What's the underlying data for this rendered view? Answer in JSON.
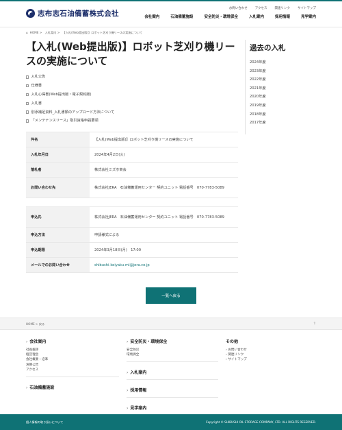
{
  "brand": {
    "name": "志布志石油備蓄株式会社"
  },
  "util_nav": [
    "お問い合わせ",
    "アクセス",
    "関連リンク",
    "サイトマップ"
  ],
  "global_nav": [
    "会社案内",
    "石油備蓄施設",
    "安全防災・環境保全",
    "入札案内",
    "採用情報",
    "見学案内"
  ],
  "breadcrumb": [
    "HOME",
    "入札案内",
    "【入札(Web提出版)】ロボット芝刈り機リースの実施について"
  ],
  "page_title": "【入札(Web提出版)】ロボット芝刈り機リースの実施について",
  "documents": [
    "入札公告",
    "仕様書",
    "入札心得書(Web提出版・電子契約版)",
    "入札書",
    "別添補足資料_入札書類のアップロード方法について",
    "「メンテナンスリース」取引資格申請要領"
  ],
  "info_table": [
    {
      "label": "件名",
      "value": "【入札(Web提出版)】ロボット芝刈り機リースの実施について"
    },
    {
      "label": "入札年月日",
      "value": "2024年4月2日(火)"
    },
    {
      "label": "落札者",
      "value": "株式会社ミズホ商会"
    },
    {
      "label": "お問い合わせ先",
      "value": "株式会社JERA　石油備蓄運用センター 契約ユニット 電話番号　070-7783-5089"
    }
  ],
  "apply_table": [
    {
      "label": "申込先",
      "value": "株式会社JERA　石油備蓄運用センター 契約ユニット 電話番号　070-7783-5089"
    },
    {
      "label": "申込方法",
      "value": "申請様式による"
    },
    {
      "label": "申込期限",
      "value": "2024年3月18日(月)　17:00"
    },
    {
      "label": "メールでのお問い合わせ",
      "value": "shibushi-keiyaku-ml@jera.co.jp"
    }
  ],
  "back_button": "一覧へ戻る",
  "sidebar": {
    "title": "過去の入札",
    "years": [
      "2024年度",
      "2023年度",
      "2022年度",
      "2021年度",
      "2020年度",
      "2019年度",
      "2018年度",
      "2017年度"
    ]
  },
  "footer_crumb": "HOME > 戻る",
  "footer_totop": "⇧",
  "footer": {
    "col1": {
      "head1": "会社案内",
      "items": [
        "社長挨拶",
        "経営理念",
        "会社概要・沿革",
        "決算公告",
        "アクセス"
      ],
      "head2": "石油備蓄施設"
    },
    "col2": {
      "head1": "安全防災・環境保全",
      "items": [
        "安全防災",
        "環境保全"
      ],
      "head2": "入札案内",
      "head3": "採用情報",
      "head4": "見学案内"
    },
    "col3": {
      "head1": "その他",
      "items": [
        "お問い合わせ",
        "関連リンク",
        "サイトマップ"
      ]
    }
  },
  "bottom": {
    "left": "個人情報の取り扱いについて",
    "right": "Copyright © SHIBUSHI OIL STORAGE COMPANY, LTD. ALL RIGHTS RESERVED."
  }
}
